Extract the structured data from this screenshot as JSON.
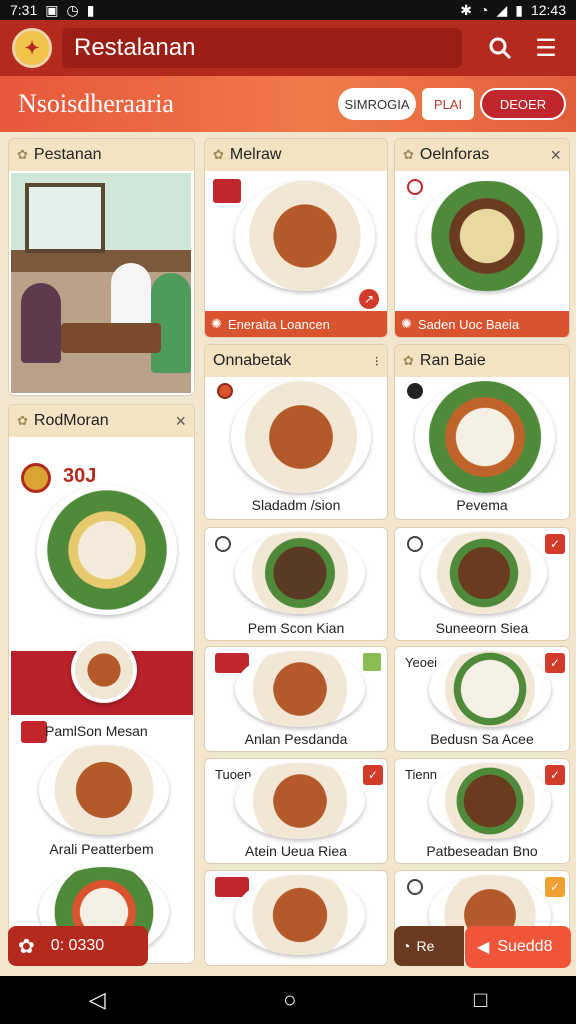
{
  "status": {
    "time": "7:31",
    "right": "12:43"
  },
  "appbar": {
    "title": "Restalanan",
    "search_icon": "search-icon",
    "menu_icon": "menu-icon"
  },
  "banner": {
    "title": "Nsoisdheraaria",
    "pill_a": "SIMROGIA",
    "pill_b": "PLAI",
    "pill_c": "DEOER"
  },
  "left": {
    "card1_title": "Pestanan",
    "card2_title": "RodMoran",
    "badge_text": "30J",
    "item1": "PamlSon Mesan",
    "item2": "Arali Peatterbem"
  },
  "cards": [
    {
      "title": "Melraw",
      "caption": "Eneraita Loancen"
    },
    {
      "title": "Oelnforas",
      "caption": "Saden Uoc Baeia"
    },
    {
      "title": "Onnabetak",
      "caption": "Sladadm /sion"
    },
    {
      "title": "Ran Baie",
      "caption": "Pevema"
    },
    {
      "caption": "Pem Scon Kian"
    },
    {
      "caption": "Suneeorn Siea"
    },
    {
      "caption": "Anlan Pesdanda"
    },
    {
      "tag": "Yeoei",
      "caption": "Bedusn Sa Acee"
    },
    {
      "tag": "Tuoen",
      "caption": "Atein Ueua Riea"
    },
    {
      "tag": "Tienn",
      "caption": "Patbeseadan Bno"
    }
  ],
  "fab": {
    "left_value": "0: 0330",
    "mid_label": "Re",
    "right_label": "Suedd8"
  }
}
